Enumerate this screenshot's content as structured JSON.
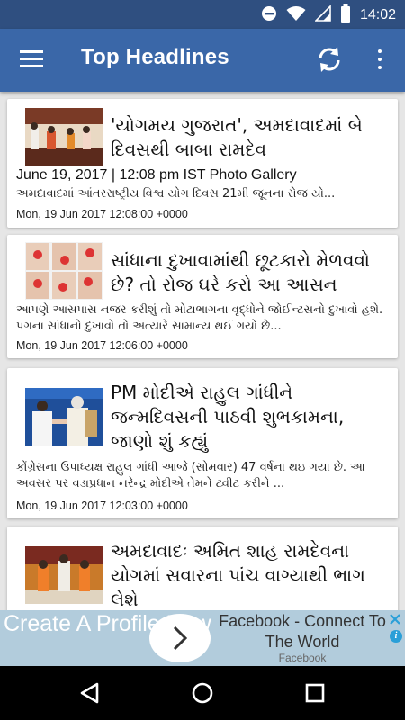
{
  "status_bar": {
    "time": "14:02",
    "icons": [
      "do-not-disturb-icon",
      "wifi-icon",
      "signal-icon",
      "battery-icon"
    ]
  },
  "app_bar": {
    "title": "Top Headlines",
    "icons": [
      "hamburger-menu-icon",
      "refresh-icon",
      "more-vert-icon"
    ]
  },
  "articles": [
    {
      "title": "'યોગમય ગુજરાત', અમદાવાદમાં બે દિવસથી બાબા રામદેવ",
      "meta": "June 19, 2017 | 12:08 pm IST  Photo Gallery",
      "description": "અમદાવાદમાં આંતરરાષ્ટ્રીય વિશ્વ યોગ દિવસ 21મી જૂનના રોજ યો...",
      "date": "Mon, 19 Jun 2017 12:08:00 +0000"
    },
    {
      "title": "સાંધાના દુખાવામાંથી છૂટકારો મેળવવો છે? તો રોજ ઘરે કરો આ આસન",
      "description": "આપણે આસપાસ નજર કરીશું તો મોટાભાગના વૃદ્ધોને જોઈન્ટસનો દુખાવો હશે. પગના સાંધાનો દુખાવો તો અત્યારે સામાન્ય થઈ ગયો છે...",
      "date": "Mon, 19 Jun 2017 12:06:00 +0000"
    },
    {
      "title": "PM મોદીએ રાહુલ ગાંધીને જન્મદિવસની પાઠવી શુભકામના, જાણો શું કહ્યું",
      "description": "કોંગ્રેસના ઉપાધ્યક્ષ રાહુલ ગાંધી આજે (સોમવાર) 47 વર્ષના થઇ ગયા છે. આ અવસર પર વડાપ્રધાન નરેન્દ્ર મોદીએ તેમને ટ્વીટ કરીને ...",
      "date": "Mon, 19 Jun 2017 12:03:00 +0000"
    },
    {
      "title": "અમદાવાદઃ અમિત શાહ રામદેવના યોગમાં સવારના પાંચ વાગ્યાથી ભાગ લેશે"
    }
  ],
  "ad": {
    "cta": "Create A Profile Now",
    "title": "Facebook - Connect To The World",
    "source": "Facebook",
    "icons": [
      "ad-arrow-icon",
      "ad-close-icon",
      "ad-info-icon"
    ]
  },
  "nav_bar": {
    "icons": [
      "back-icon",
      "home-icon",
      "recents-icon"
    ]
  },
  "colors": {
    "status_bar": "#2f4f80",
    "app_bar": "#3a67a8",
    "background": "#e6e6e6",
    "ad_background": "#b2ccdc"
  }
}
